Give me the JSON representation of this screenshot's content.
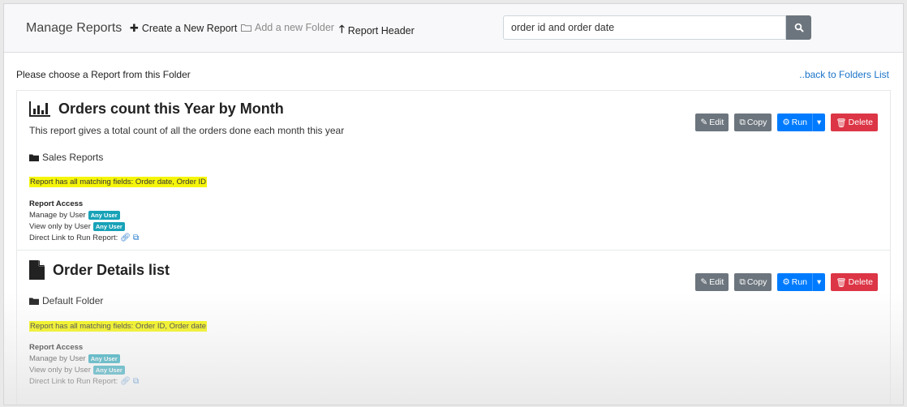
{
  "header": {
    "brand": "Manage Reports",
    "create_report": "Create a New Report",
    "add_folder": "Add a new Folder",
    "report_header": "Report Header"
  },
  "search": {
    "value": "order id and order date"
  },
  "intro": "Please choose a Report from this Folder",
  "back_link": "..back to Folders List",
  "buttons": {
    "edit": "Edit",
    "copy": "Copy",
    "run": "Run",
    "delete": "Delete"
  },
  "access": {
    "heading": "Report Access",
    "manage_label": "Manage by User",
    "view_label": "View only by User",
    "direct_label": "Direct Link to Run Report:",
    "badge": "Any User"
  },
  "reports": [
    {
      "title": "Orders count this Year by Month",
      "description": "This report gives a total count of all the orders done each month this year",
      "folder": "Sales Reports",
      "matching": "Report has all matching fields: Order date, Order ID"
    },
    {
      "title": "Order Details list",
      "description": "",
      "folder": "Default Folder",
      "matching": "Report has all matching fields: Order ID, Order date"
    }
  ],
  "colors": {
    "primary": "#007bff",
    "danger": "#dc3545",
    "secondary": "#6c757d",
    "info": "#17a2b8",
    "highlight": "#f5f50a"
  }
}
